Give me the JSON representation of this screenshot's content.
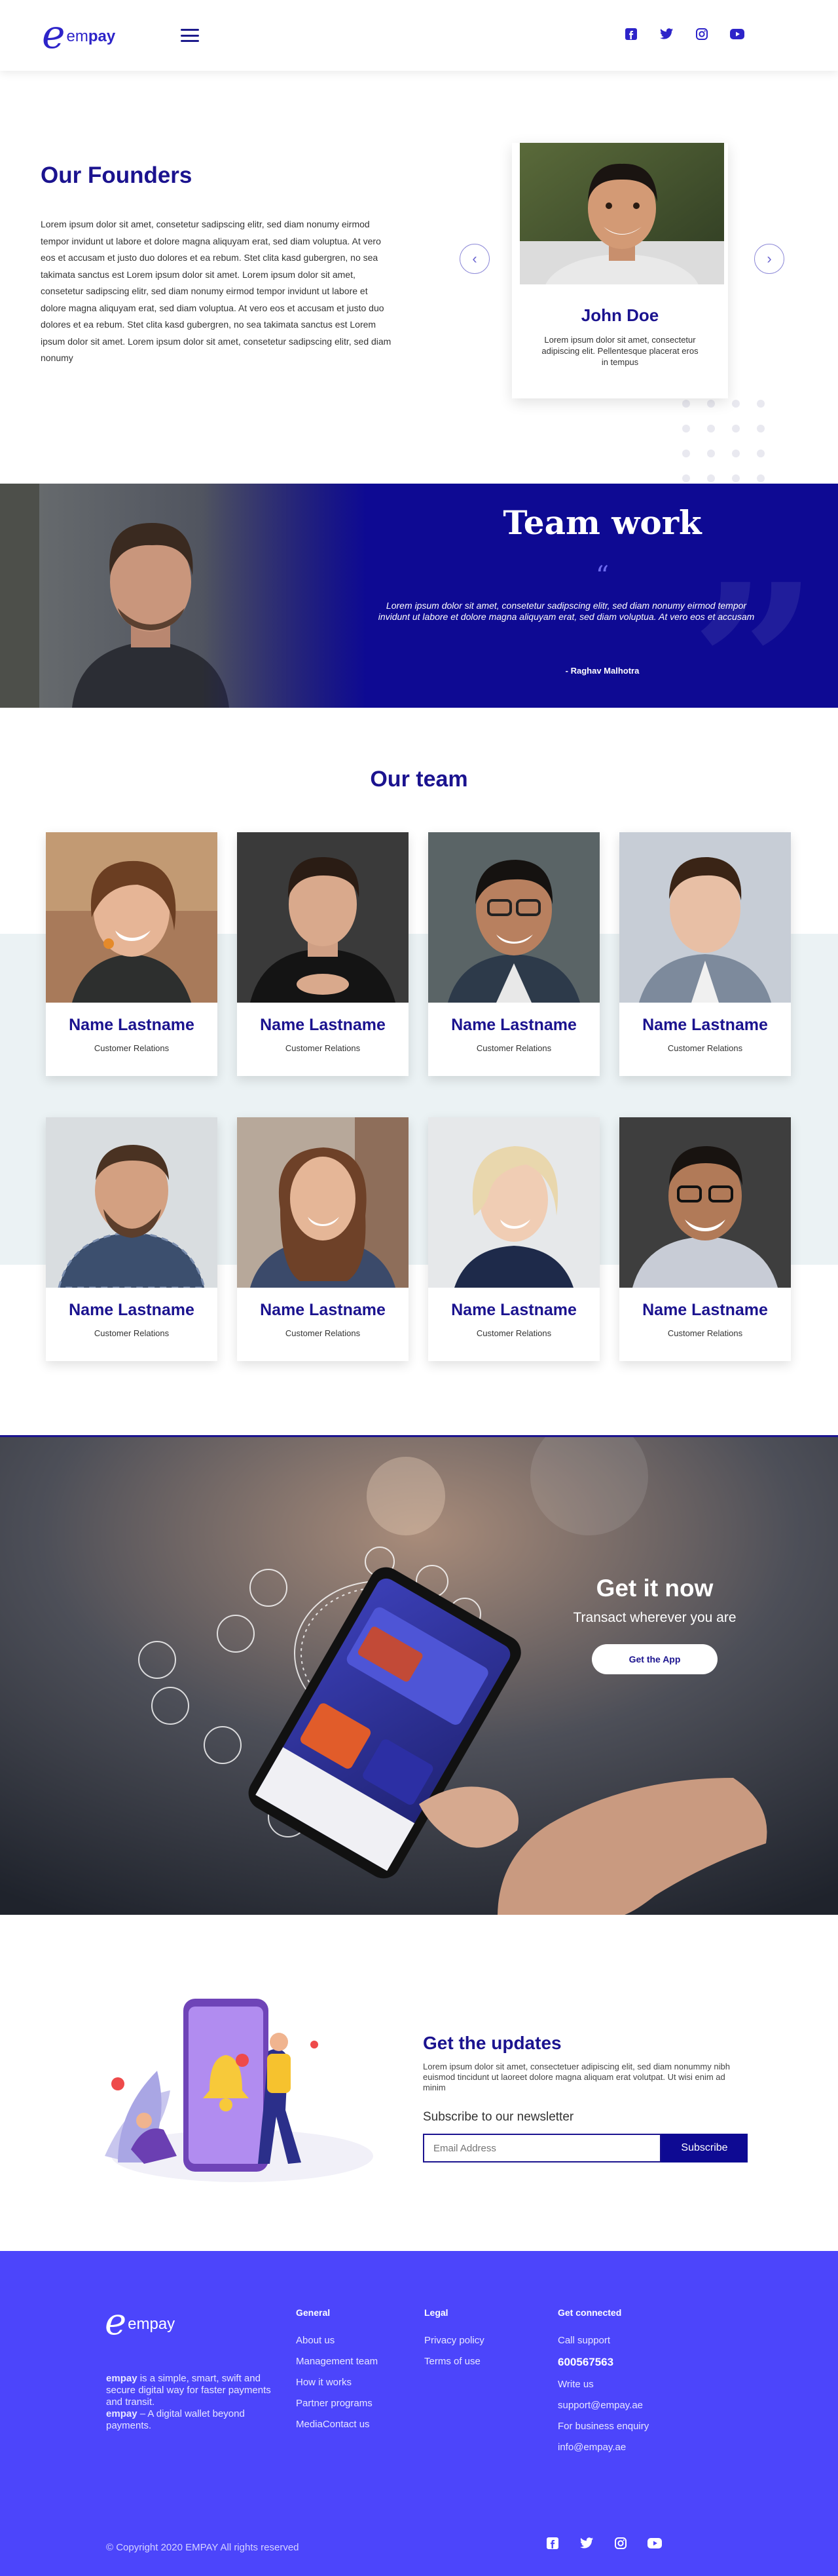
{
  "header": {
    "logo_letter": "e",
    "logo_prefix": "em",
    "logo_bold": "pay",
    "social_icons": [
      "facebook-icon",
      "twitter-icon",
      "instagram-icon",
      "youtube-icon"
    ],
    "icon_color": "#2d24c9"
  },
  "founders": {
    "title": "Our Founders",
    "body": "Lorem ipsum dolor sit amet, consetetur sadipscing elitr, sed diam nonumy eirmod tempor invidunt ut labore et dolore magna aliquyam erat, sed diam voluptua. At vero eos et accusam et justo duo dolores et ea rebum. Stet clita kasd gubergren, no sea takimata sanctus est Lorem ipsum dolor sit amet. Lorem ipsum dolor sit amet, consetetur sadipscing elitr, sed diam nonumy eirmod tempor invidunt ut labore et dolore magna aliquyam erat, sed diam voluptua. At vero eos et accusam et justo duo dolores et ea rebum. Stet clita kasd gubergren, no sea takimata sanctus est Lorem ipsum dolor sit amet. Lorem ipsum dolor sit amet, consetetur sadipscing elitr, sed diam nonumy",
    "card": {
      "name": "John Doe",
      "description": "Lorem ipsum dolor sit amet, consectetur adipiscing elit. Pellentesque placerat eros in tempus"
    },
    "prev_arrow": "‹",
    "next_arrow": "›",
    "slides_total": 3,
    "active_slide": 1
  },
  "teamwork": {
    "title": "Team work",
    "quote_mark": "“",
    "text": "Lorem ipsum dolor sit amet, consetetur sadipscing elitr, sed diam nonumy eirmod tempor invidunt ut labore et dolore magna aliquyam erat, sed diam voluptua. At vero eos et accusam",
    "author": "- Raghav Malhotra",
    "bg_color": "#0e0a93"
  },
  "team": {
    "title": "Our team",
    "members": [
      {
        "name": "Name Lastname",
        "role": "Customer Relations"
      },
      {
        "name": "Name Lastname",
        "role": "Customer Relations"
      },
      {
        "name": "Name Lastname",
        "role": "Customer Relations"
      },
      {
        "name": "Name Lastname",
        "role": "Customer Relations"
      },
      {
        "name": "Name Lastname",
        "role": "Customer Relations"
      },
      {
        "name": "Name Lastname",
        "role": "Customer Relations"
      },
      {
        "name": "Name Lastname",
        "role": "Customer Relations"
      },
      {
        "name": "Name Lastname",
        "role": "Customer Relations"
      }
    ]
  },
  "getit": {
    "title": "Get it now",
    "subtitle": "Transact wherever you are",
    "button": "Get the App"
  },
  "updates": {
    "title": "Get the updates",
    "text": "Lorem ipsum dolor sit amet, consectetuer adipiscing elit, sed diam nonummy nibh euismod tincidunt ut laoreet dolore magna aliquam erat volutpat. Ut wisi enim ad minim",
    "subscribe_label": "Subscribe to our newsletter",
    "email_placeholder": "Email Address",
    "button": "Subscribe"
  },
  "footer": {
    "desc_1_bold": "em",
    "desc_1_bold2": "pay",
    "desc_1": " is a simple, smart, swift and secure digital way for faster payments and transit.",
    "desc_2_bold": "em",
    "desc_2_bold2": "pay",
    "desc_2": " – A digital wallet beyond payments.",
    "columns": [
      {
        "title": "General",
        "links": [
          "About us",
          "Management team",
          "How it works",
          "Partner programs",
          "MediaContact us"
        ]
      },
      {
        "title": "Legal",
        "links": [
          "Privacy policy",
          "Terms of use"
        ]
      },
      {
        "title": "Get connected",
        "links": [
          "Call support",
          "600567563",
          "Write us",
          "support@empay.ae",
          "For business enquiry",
          "info@empay.ae"
        ]
      }
    ],
    "copyright": "© Copyright 2020 EMPAY All rights reserved",
    "bg_color": "#4c45fb"
  }
}
